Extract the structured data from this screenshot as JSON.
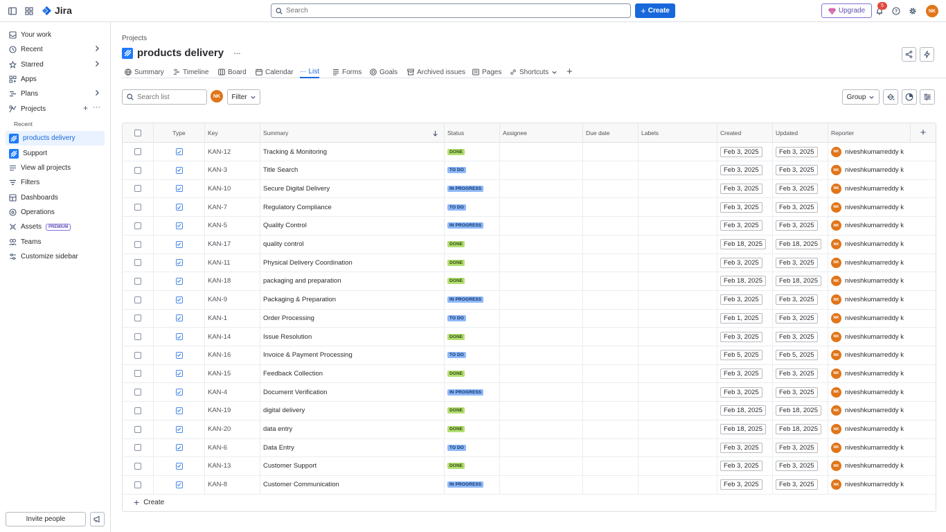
{
  "topbar": {
    "app_name": "Jira",
    "search_placeholder": "Search",
    "create_label": "Create",
    "upgrade_label": "Upgrade",
    "notification_count": "5",
    "user_initials": "NK"
  },
  "sidebar": {
    "items": [
      {
        "label": "Your work"
      },
      {
        "label": "Recent"
      },
      {
        "label": "Starred"
      },
      {
        "label": "Apps"
      },
      {
        "label": "Plans"
      },
      {
        "label": "Projects"
      },
      {
        "label": "Filters"
      },
      {
        "label": "Dashboards"
      },
      {
        "label": "Operations"
      },
      {
        "label": "Assets"
      },
      {
        "label": "Teams"
      },
      {
        "label": "Customize sidebar"
      }
    ],
    "recent_heading": "Recent",
    "projects": [
      {
        "label": "products delivery"
      },
      {
        "label": "Support"
      }
    ],
    "view_all_label": "View all projects",
    "premium_badge": "PREMIUM",
    "invite_label": "Invite people"
  },
  "header": {
    "breadcrumb": "Projects",
    "project_name": "products delivery",
    "more": "···"
  },
  "tabs": [
    {
      "label": "Summary"
    },
    {
      "label": "Timeline"
    },
    {
      "label": "Board"
    },
    {
      "label": "Calendar"
    },
    {
      "label": "List"
    },
    {
      "label": "Forms"
    },
    {
      "label": "Goals"
    },
    {
      "label": "Archived issues"
    },
    {
      "label": "Pages"
    },
    {
      "label": "Shortcuts"
    }
  ],
  "toolbar": {
    "search_placeholder": "Search list",
    "filter_avatar": "NK",
    "filter_label": "Filter",
    "group_label": "Group"
  },
  "table": {
    "columns": [
      "Type",
      "Key",
      "Summary",
      "Status",
      "Assignee",
      "Due date",
      "Labels",
      "Created",
      "Updated",
      "Reporter"
    ],
    "rows": [
      {
        "key": "KAN-12",
        "summary": "Tracking & Monitoring",
        "status": "DONE",
        "status_class": "st-done",
        "created": "Feb 3, 2025",
        "updated": "Feb 3, 2025",
        "reporter": "niveshkumarreddy k",
        "initials": "NK"
      },
      {
        "key": "KAN-3",
        "summary": "Title Search",
        "status": "TO DO",
        "status_class": "st-todo",
        "created": "Feb 3, 2025",
        "updated": "Feb 3, 2025",
        "reporter": "niveshkumarreddy k",
        "initials": "NK"
      },
      {
        "key": "KAN-10",
        "summary": "Secure Digital Delivery",
        "status": "IN PROGRESS",
        "status_class": "st-inprogress",
        "created": "Feb 3, 2025",
        "updated": "Feb 3, 2025",
        "reporter": "niveshkumarreddy k",
        "initials": "NK"
      },
      {
        "key": "KAN-7",
        "summary": "Regulatory Compliance",
        "status": "TO DO",
        "status_class": "st-todo",
        "created": "Feb 3, 2025",
        "updated": "Feb 3, 2025",
        "reporter": "niveshkumarreddy k",
        "initials": "NK"
      },
      {
        "key": "KAN-5",
        "summary": "Quality Control",
        "status": "IN PROGRESS",
        "status_class": "st-inprogress",
        "created": "Feb 3, 2025",
        "updated": "Feb 3, 2025",
        "reporter": "niveshkumarreddy k",
        "initials": "NK"
      },
      {
        "key": "KAN-17",
        "summary": "quality control",
        "status": "DONE",
        "status_class": "st-done",
        "created": "Feb 18, 2025",
        "updated": "Feb 18, 2025",
        "reporter": "niveshkumarreddy k",
        "initials": "NK"
      },
      {
        "key": "KAN-11",
        "summary": "Physical Delivery Coordination",
        "status": "DONE",
        "status_class": "st-done",
        "created": "Feb 3, 2025",
        "updated": "Feb 3, 2025",
        "reporter": "niveshkumarreddy k",
        "initials": "NK"
      },
      {
        "key": "KAN-18",
        "summary": "packaging and preparation",
        "status": "DONE",
        "status_class": "st-done",
        "created": "Feb 18, 2025",
        "updated": "Feb 18, 2025",
        "reporter": "niveshkumarreddy k",
        "initials": "NK"
      },
      {
        "key": "KAN-9",
        "summary": "Packaging & Preparation",
        "status": "IN PROGRESS",
        "status_class": "st-inprogress",
        "created": "Feb 3, 2025",
        "updated": "Feb 3, 2025",
        "reporter": "niveshkumarreddy k",
        "initials": "NK"
      },
      {
        "key": "KAN-1",
        "summary": "Order Processing",
        "status": "TO DO",
        "status_class": "st-todo",
        "created": "Feb 1, 2025",
        "updated": "Feb 3, 2025",
        "reporter": "niveshkumarreddy k",
        "initials": "NK"
      },
      {
        "key": "KAN-14",
        "summary": "Issue Resolution",
        "status": "DONE",
        "status_class": "st-done",
        "created": "Feb 3, 2025",
        "updated": "Feb 3, 2025",
        "reporter": "niveshkumarreddy k",
        "initials": "NK"
      },
      {
        "key": "KAN-16",
        "summary": "Invoice & Payment Processing",
        "status": "TO DO",
        "status_class": "st-todo",
        "created": "Feb 5, 2025",
        "updated": "Feb 5, 2025",
        "reporter": "niveshkumarreddy k",
        "initials": "NK"
      },
      {
        "key": "KAN-15",
        "summary": "Feedback Collection",
        "status": "DONE",
        "status_class": "st-done",
        "created": "Feb 3, 2025",
        "updated": "Feb 3, 2025",
        "reporter": "niveshkumarreddy k",
        "initials": "NK"
      },
      {
        "key": "KAN-4",
        "summary": "Document Verification",
        "status": "IN PROGRESS",
        "status_class": "st-inprogress",
        "created": "Feb 3, 2025",
        "updated": "Feb 3, 2025",
        "reporter": "niveshkumarreddy k",
        "initials": "NK"
      },
      {
        "key": "KAN-19",
        "summary": "digital delivery",
        "status": "DONE",
        "status_class": "st-done",
        "created": "Feb 18, 2025",
        "updated": "Feb 18, 2025",
        "reporter": "niveshkumarreddy k",
        "initials": "NK"
      },
      {
        "key": "KAN-20",
        "summary": "data entry",
        "status": "DONE",
        "status_class": "st-done",
        "created": "Feb 18, 2025",
        "updated": "Feb 18, 2025",
        "reporter": "niveshkumarreddy k",
        "initials": "NK"
      },
      {
        "key": "KAN-6",
        "summary": "Data Entry",
        "status": "TO DO",
        "status_class": "st-todo",
        "created": "Feb 3, 2025",
        "updated": "Feb 3, 2025",
        "reporter": "niveshkumarreddy k",
        "initials": "NK"
      },
      {
        "key": "KAN-13",
        "summary": "Customer Support",
        "status": "DONE",
        "status_class": "st-done",
        "created": "Feb 3, 2025",
        "updated": "Feb 3, 2025",
        "reporter": "niveshkumarreddy k",
        "initials": "NK"
      },
      {
        "key": "KAN-8",
        "summary": "Customer Communication",
        "status": "IN PROGRESS",
        "status_class": "st-inprogress",
        "created": "Feb 3, 2025",
        "updated": "Feb 3, 2025",
        "reporter": "niveshkumarreddy k",
        "initials": "NK"
      }
    ],
    "create_label": "Create"
  }
}
